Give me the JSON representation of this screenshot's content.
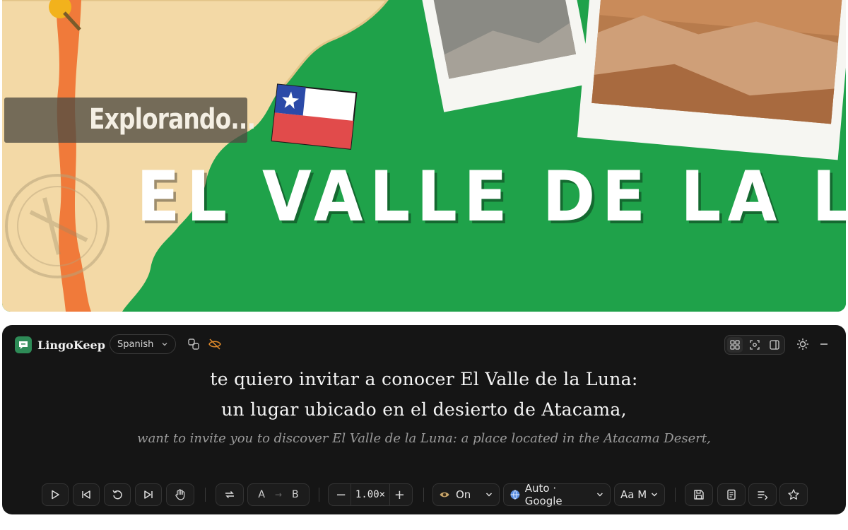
{
  "video": {
    "overlay_label": "Explorando...",
    "title": "EL VALLE DE LA LUNA",
    "colors": {
      "background": "#1fa24a",
      "map": "#f3d9a6",
      "chile": "#f07a3a"
    }
  },
  "panel": {
    "app_name": "LingoKeep",
    "language": "Spanish",
    "subtitle_lines": [
      "te quiero invitar a conocer El Valle de la Luna:",
      "un lugar ubicado en el desierto de Atacama,"
    ],
    "translation": "want to invite you to discover El Valle de la Luna: a place located in the Atacama Desert,",
    "controls": {
      "loop_a": "A",
      "loop_b": "B",
      "speed": "1.00×",
      "visibility": "On",
      "translator": "Auto · Google",
      "font_size": "Aa M"
    },
    "icons": [
      "chat-icon",
      "swap-icon",
      "eye-off-icon",
      "grid-icon",
      "scan-icon",
      "sidebar-icon",
      "sun-icon",
      "minimize-icon",
      "play-icon",
      "skip-back-icon",
      "replay-icon",
      "skip-forward-icon",
      "hand-icon",
      "repeat-icon",
      "eye-icon",
      "globe-icon",
      "save-icon",
      "notes-icon",
      "list-icon",
      "star-icon"
    ]
  }
}
